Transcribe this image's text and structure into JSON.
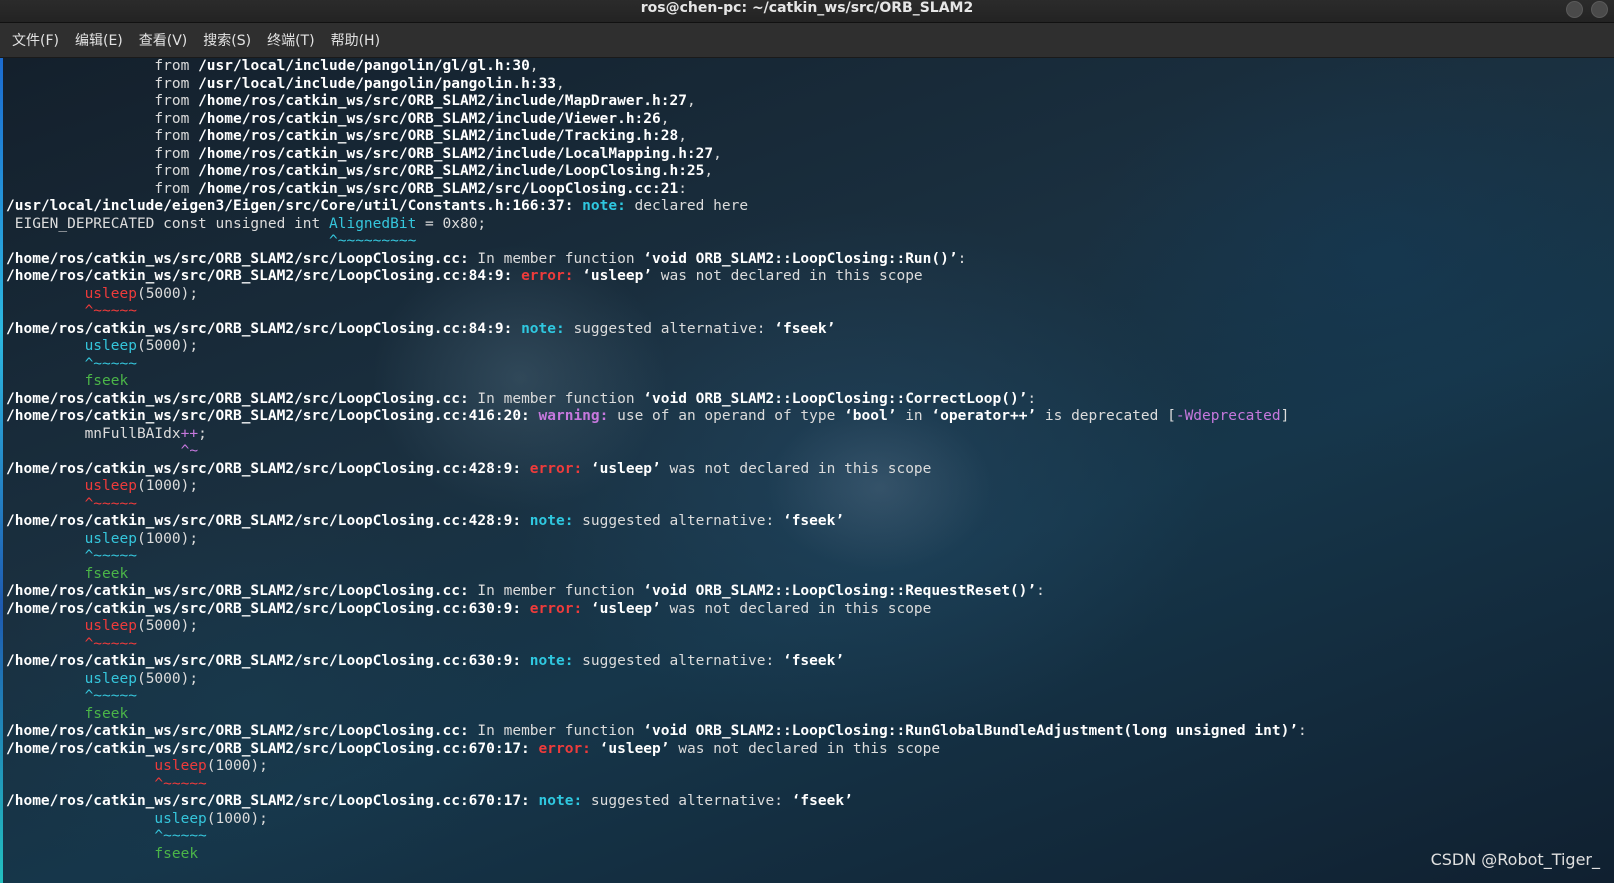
{
  "window": {
    "title": "ros@chen-pc: ~/catkin_ws/src/ORB_SLAM2"
  },
  "menu": [
    {
      "label": "文件(F)"
    },
    {
      "label": "编辑(E)"
    },
    {
      "label": "查看(V)"
    },
    {
      "label": "搜索(S)"
    },
    {
      "label": "终端(T)"
    },
    {
      "label": "帮助(H)"
    }
  ],
  "terminal": {
    "lines": [
      [
        {
          "t": "                 from "
        },
        {
          "t": "/usr/local/include/pangolin/gl/gl.h:30",
          "c": "b"
        },
        {
          "t": ","
        }
      ],
      [
        {
          "t": "                 from "
        },
        {
          "t": "/usr/local/include/pangolin/pangolin.h:33",
          "c": "b"
        },
        {
          "t": ","
        }
      ],
      [
        {
          "t": "                 from "
        },
        {
          "t": "/home/ros/catkin_ws/src/ORB_SLAM2/include/MapDrawer.h:27",
          "c": "b"
        },
        {
          "t": ","
        }
      ],
      [
        {
          "t": "                 from "
        },
        {
          "t": "/home/ros/catkin_ws/src/ORB_SLAM2/include/Viewer.h:26",
          "c": "b"
        },
        {
          "t": ","
        }
      ],
      [
        {
          "t": "                 from "
        },
        {
          "t": "/home/ros/catkin_ws/src/ORB_SLAM2/include/Tracking.h:28",
          "c": "b"
        },
        {
          "t": ","
        }
      ],
      [
        {
          "t": "                 from "
        },
        {
          "t": "/home/ros/catkin_ws/src/ORB_SLAM2/include/LocalMapping.h:27",
          "c": "b"
        },
        {
          "t": ","
        }
      ],
      [
        {
          "t": "                 from "
        },
        {
          "t": "/home/ros/catkin_ws/src/ORB_SLAM2/include/LoopClosing.h:25",
          "c": "b"
        },
        {
          "t": ","
        }
      ],
      [
        {
          "t": "                 from "
        },
        {
          "t": "/home/ros/catkin_ws/src/ORB_SLAM2/src/LoopClosing.cc:21",
          "c": "b"
        },
        {
          "t": ":"
        }
      ],
      [
        {
          "t": "/usr/local/include/eigen3/Eigen/src/Core/util/Constants.h:166:37:",
          "c": "b"
        },
        {
          "t": " "
        },
        {
          "t": "note:",
          "c": "note"
        },
        {
          "t": " declared here"
        }
      ],
      [
        {
          "t": " EIGEN_DEPRECATED const unsigned int "
        },
        {
          "t": "AlignedBit",
          "c": "cyan"
        },
        {
          "t": " = 0x80;"
        }
      ],
      [
        {
          "t": "                                     ^~~~~~~~~~",
          "c": "cyan"
        }
      ],
      [
        {
          "t": "/home/ros/catkin_ws/src/ORB_SLAM2/src/LoopClosing.cc:",
          "c": "b"
        },
        {
          "t": " In member function "
        },
        {
          "t": "‘void ORB_SLAM2::LoopClosing::Run()’",
          "c": "b"
        },
        {
          "t": ":"
        }
      ],
      [
        {
          "t": "/home/ros/catkin_ws/src/ORB_SLAM2/src/LoopClosing.cc:84:9:",
          "c": "b"
        },
        {
          "t": " "
        },
        {
          "t": "error:",
          "c": "err"
        },
        {
          "t": " "
        },
        {
          "t": "‘usleep’",
          "c": "b"
        },
        {
          "t": " was not declared in this scope"
        }
      ],
      [
        {
          "t": "         "
        },
        {
          "t": "usleep",
          "c": "red"
        },
        {
          "t": "(5000);"
        }
      ],
      [
        {
          "t": "         ^~~~~~",
          "c": "red"
        }
      ],
      [
        {
          "t": "/home/ros/catkin_ws/src/ORB_SLAM2/src/LoopClosing.cc:84:9:",
          "c": "b"
        },
        {
          "t": " "
        },
        {
          "t": "note:",
          "c": "note"
        },
        {
          "t": " suggested alternative: "
        },
        {
          "t": "‘fseek’",
          "c": "b"
        }
      ],
      [
        {
          "t": "         "
        },
        {
          "t": "usleep",
          "c": "cyan"
        },
        {
          "t": "(5000);"
        }
      ],
      [
        {
          "t": "         ^~~~~~",
          "c": "cyan"
        }
      ],
      [
        {
          "t": "         fseek",
          "c": "green"
        }
      ],
      [
        {
          "t": "/home/ros/catkin_ws/src/ORB_SLAM2/src/LoopClosing.cc:",
          "c": "b"
        },
        {
          "t": " In member function "
        },
        {
          "t": "‘void ORB_SLAM2::LoopClosing::CorrectLoop()’",
          "c": "b"
        },
        {
          "t": ":"
        }
      ],
      [
        {
          "t": "/home/ros/catkin_ws/src/ORB_SLAM2/src/LoopClosing.cc:416:20:",
          "c": "b"
        },
        {
          "t": " "
        },
        {
          "t": "warning:",
          "c": "warn"
        },
        {
          "t": " use of an operand of type "
        },
        {
          "t": "‘bool’",
          "c": "b"
        },
        {
          "t": " in "
        },
        {
          "t": "‘operator++’",
          "c": "b"
        },
        {
          "t": " is deprecated ["
        },
        {
          "t": "-Wdeprecated",
          "c": "purple"
        },
        {
          "t": "]"
        }
      ],
      [
        {
          "t": "         mnFullBAIdx"
        },
        {
          "t": "++",
          "c": "purple"
        },
        {
          "t": ";"
        }
      ],
      [
        {
          "t": "                    ^~",
          "c": "purple"
        }
      ],
      [
        {
          "t": "/home/ros/catkin_ws/src/ORB_SLAM2/src/LoopClosing.cc:428:9:",
          "c": "b"
        },
        {
          "t": " "
        },
        {
          "t": "error:",
          "c": "err"
        },
        {
          "t": " "
        },
        {
          "t": "‘usleep’",
          "c": "b"
        },
        {
          "t": " was not declared in this scope"
        }
      ],
      [
        {
          "t": "         "
        },
        {
          "t": "usleep",
          "c": "red"
        },
        {
          "t": "(1000);"
        }
      ],
      [
        {
          "t": "         ^~~~~~",
          "c": "red"
        }
      ],
      [
        {
          "t": "/home/ros/catkin_ws/src/ORB_SLAM2/src/LoopClosing.cc:428:9:",
          "c": "b"
        },
        {
          "t": " "
        },
        {
          "t": "note:",
          "c": "note"
        },
        {
          "t": " suggested alternative: "
        },
        {
          "t": "‘fseek’",
          "c": "b"
        }
      ],
      [
        {
          "t": "         "
        },
        {
          "t": "usleep",
          "c": "cyan"
        },
        {
          "t": "(1000);"
        }
      ],
      [
        {
          "t": "         ^~~~~~",
          "c": "cyan"
        }
      ],
      [
        {
          "t": "         fseek",
          "c": "green"
        }
      ],
      [
        {
          "t": "/home/ros/catkin_ws/src/ORB_SLAM2/src/LoopClosing.cc:",
          "c": "b"
        },
        {
          "t": " In member function "
        },
        {
          "t": "‘void ORB_SLAM2::LoopClosing::RequestReset()’",
          "c": "b"
        },
        {
          "t": ":"
        }
      ],
      [
        {
          "t": "/home/ros/catkin_ws/src/ORB_SLAM2/src/LoopClosing.cc:630:9:",
          "c": "b"
        },
        {
          "t": " "
        },
        {
          "t": "error:",
          "c": "err"
        },
        {
          "t": " "
        },
        {
          "t": "‘usleep’",
          "c": "b"
        },
        {
          "t": " was not declared in this scope"
        }
      ],
      [
        {
          "t": "         "
        },
        {
          "t": "usleep",
          "c": "red"
        },
        {
          "t": "(5000);"
        }
      ],
      [
        {
          "t": "         ^~~~~~",
          "c": "red"
        }
      ],
      [
        {
          "t": "/home/ros/catkin_ws/src/ORB_SLAM2/src/LoopClosing.cc:630:9:",
          "c": "b"
        },
        {
          "t": " "
        },
        {
          "t": "note:",
          "c": "note"
        },
        {
          "t": " suggested alternative: "
        },
        {
          "t": "‘fseek’",
          "c": "b"
        }
      ],
      [
        {
          "t": "         "
        },
        {
          "t": "usleep",
          "c": "cyan"
        },
        {
          "t": "(5000);"
        }
      ],
      [
        {
          "t": "         ^~~~~~",
          "c": "cyan"
        }
      ],
      [
        {
          "t": "         fseek",
          "c": "green"
        }
      ],
      [
        {
          "t": "/home/ros/catkin_ws/src/ORB_SLAM2/src/LoopClosing.cc:",
          "c": "b"
        },
        {
          "t": " In member function "
        },
        {
          "t": "‘void ORB_SLAM2::LoopClosing::RunGlobalBundleAdjustment(long unsigned int)’",
          "c": "b"
        },
        {
          "t": ":"
        }
      ],
      [
        {
          "t": "/home/ros/catkin_ws/src/ORB_SLAM2/src/LoopClosing.cc:670:17:",
          "c": "b"
        },
        {
          "t": " "
        },
        {
          "t": "error:",
          "c": "err"
        },
        {
          "t": " "
        },
        {
          "t": "‘usleep’",
          "c": "b"
        },
        {
          "t": " was not declared in this scope"
        }
      ],
      [
        {
          "t": "                 "
        },
        {
          "t": "usleep",
          "c": "red"
        },
        {
          "t": "(1000);"
        }
      ],
      [
        {
          "t": "                 ^~~~~~",
          "c": "red"
        }
      ],
      [
        {
          "t": "/home/ros/catkin_ws/src/ORB_SLAM2/src/LoopClosing.cc:670:17:",
          "c": "b"
        },
        {
          "t": " "
        },
        {
          "t": "note:",
          "c": "note"
        },
        {
          "t": " suggested alternative: "
        },
        {
          "t": "‘fseek’",
          "c": "b"
        }
      ],
      [
        {
          "t": "                 "
        },
        {
          "t": "usleep",
          "c": "cyan"
        },
        {
          "t": "(1000);"
        }
      ],
      [
        {
          "t": "                 ^~~~~~",
          "c": "cyan"
        }
      ],
      [
        {
          "t": "                 fseek",
          "c": "green"
        }
      ]
    ]
  },
  "watermark": "CSDN @Robot_Tiger_",
  "colors": {
    "error": "#ef3b3b",
    "warning": "#c678dd",
    "note": "#2fc8e0",
    "suggestion": "#4bb548"
  }
}
